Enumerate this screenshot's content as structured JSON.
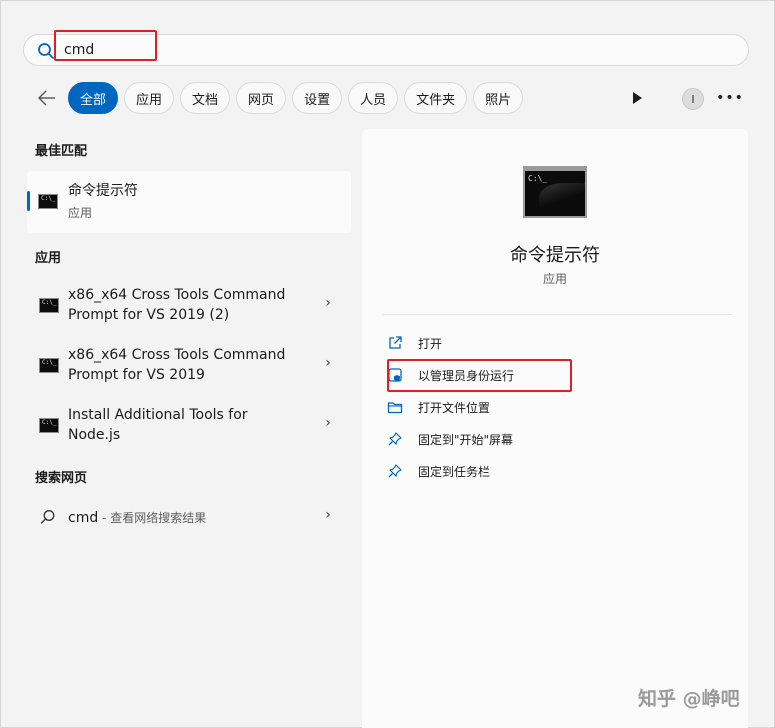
{
  "search": {
    "value": "cmd"
  },
  "filters": [
    {
      "label": "全部",
      "active": true
    },
    {
      "label": "应用",
      "active": false
    },
    {
      "label": "文档",
      "active": false
    },
    {
      "label": "网页",
      "active": false
    },
    {
      "label": "设置",
      "active": false
    },
    {
      "label": "人员",
      "active": false
    },
    {
      "label": "文件夹",
      "active": false
    },
    {
      "label": "照片",
      "active": false
    }
  ],
  "account_initial": "I",
  "best_match": {
    "heading": "最佳匹配",
    "title": "命令提示符",
    "subtitle": "应用"
  },
  "apps": {
    "heading": "应用",
    "items": [
      {
        "line1": "x86_x64 Cross Tools Command",
        "line2": "Prompt for VS 2019 (2)"
      },
      {
        "line1": "x86_x64 Cross Tools Command",
        "line2": "Prompt for VS 2019"
      },
      {
        "line1": "Install Additional Tools for",
        "line2": "Node.js"
      }
    ]
  },
  "web": {
    "heading": "搜索网页",
    "query": "cmd",
    "suffix": " - 查看网络搜索结果"
  },
  "detail": {
    "title": "命令提示符",
    "type": "应用",
    "actions": [
      {
        "label": "打开",
        "icon": "open-external-icon"
      },
      {
        "label": "以管理员身份运行",
        "icon": "shield-admin-icon"
      },
      {
        "label": "打开文件位置",
        "icon": "folder-icon"
      },
      {
        "label": "固定到\"开始\"屏幕",
        "icon": "pin-icon"
      },
      {
        "label": "固定到任务栏",
        "icon": "pin-icon"
      }
    ]
  },
  "cmd_icon_text": "C:\\_",
  "watermark": "知乎 @峥吧",
  "colors": {
    "accent": "#0067c0",
    "highlight": "#e02020"
  }
}
